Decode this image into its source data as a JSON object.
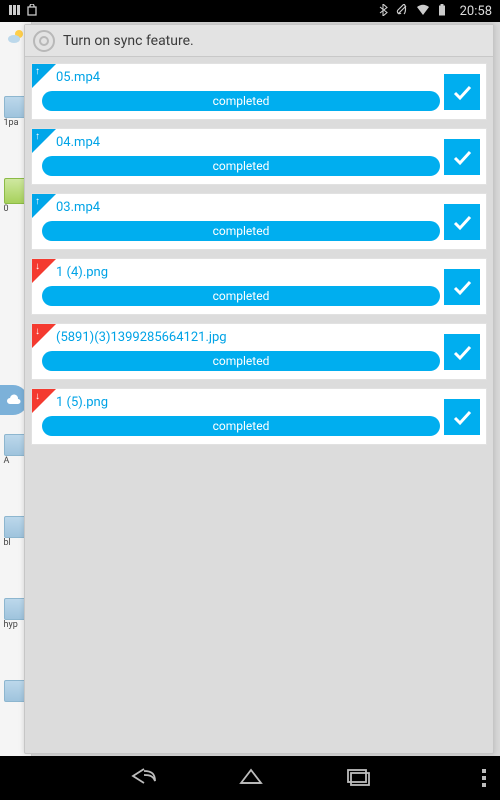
{
  "statusbar": {
    "clock": "20:58"
  },
  "panel": {
    "header_text": "Turn on sync feature."
  },
  "bg": {
    "labels": [
      "1pa",
      "0",
      "A",
      "bl",
      "hyp"
    ]
  },
  "items": [
    {
      "filename": "05.mp4",
      "status": "completed",
      "direction": "up"
    },
    {
      "filename": "04.mp4",
      "status": "completed",
      "direction": "up"
    },
    {
      "filename": "03.mp4",
      "status": "completed",
      "direction": "up"
    },
    {
      "filename": "1 (4).png",
      "status": "completed",
      "direction": "down"
    },
    {
      "filename": "(5891)(3)1399285664121.jpg",
      "status": "completed",
      "direction": "down"
    },
    {
      "filename": "1 (5).png",
      "status": "completed",
      "direction": "down"
    }
  ]
}
